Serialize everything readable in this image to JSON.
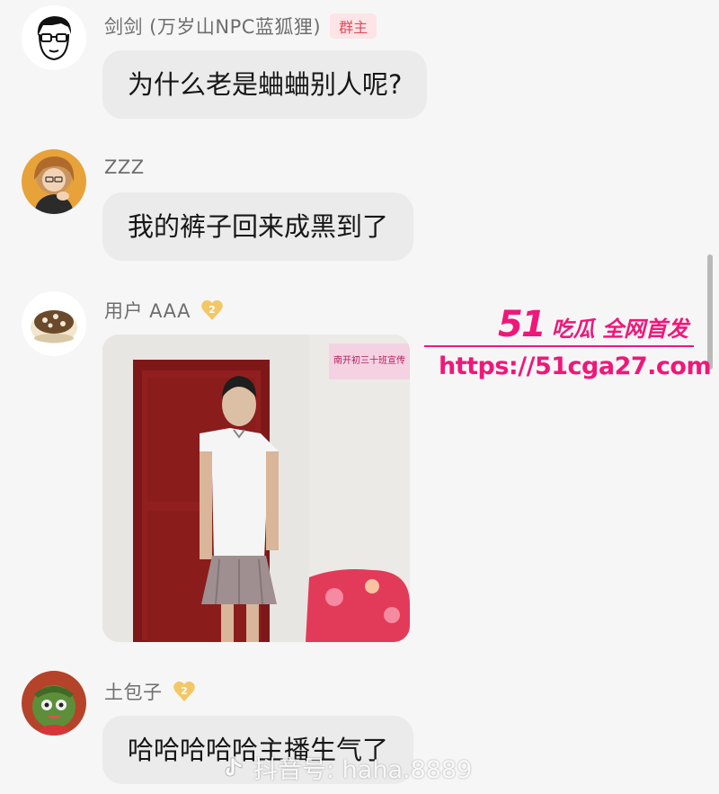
{
  "messages": [
    {
      "sender": "剑剑 (万岁山NPC蓝狐狸)",
      "role_badge": "群主",
      "text": "为什么老是蛐蛐别人呢?"
    },
    {
      "sender": "ZZZ",
      "text": "我的裤子回来成黑到了"
    },
    {
      "sender": "用户 AAA",
      "level": "2",
      "image_banner": "南开初三十班宣传"
    },
    {
      "sender": "土包子",
      "level": "2",
      "text": "哈哈哈哈哈主播生气了"
    }
  ],
  "watermarks": {
    "brand_number": "51",
    "brand_slogan": "吃瓜 全网首发",
    "url": "https://51cga27.com",
    "douyin_id": "抖音号: haha.8889"
  },
  "colors": {
    "accent": "#f0177a",
    "bubble": "#ebebeb",
    "badge_text": "#e04a5a"
  }
}
